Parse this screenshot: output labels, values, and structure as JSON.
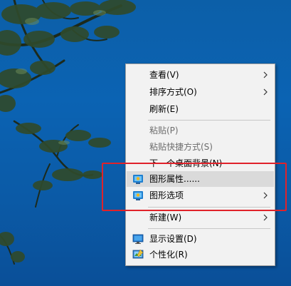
{
  "context_menu": {
    "items": [
      {
        "label": "查看(V)",
        "submenu": true,
        "disabled": false
      },
      {
        "label": "排序方式(O)",
        "submenu": true,
        "disabled": false
      },
      {
        "label": "刷新(E)",
        "submenu": false,
        "disabled": false
      },
      {
        "label": "粘贴(P)",
        "submenu": false,
        "disabled": true
      },
      {
        "label": "粘贴快捷方式(S)",
        "submenu": false,
        "disabled": true
      },
      {
        "label": "下一个桌面背景(N)",
        "submenu": false,
        "disabled": false
      },
      {
        "label": "图形属性......",
        "submenu": false,
        "disabled": false,
        "icon": "intel-graphics-icon",
        "highlighted": true
      },
      {
        "label": "图形选项",
        "submenu": true,
        "disabled": false,
        "icon": "intel-graphics-icon"
      },
      {
        "label": "新建(W)",
        "submenu": true,
        "disabled": false
      },
      {
        "label": "显示设置(D)",
        "submenu": false,
        "disabled": false,
        "icon": "display-icon"
      },
      {
        "label": "个性化(R)",
        "submenu": false,
        "disabled": false,
        "icon": "personalize-icon"
      }
    ]
  },
  "annotation": {
    "color": "#e0222a"
  },
  "colors": {
    "desktop_sky": "#0b63b3",
    "menu_bg": "#f2f2f2",
    "hover_bg": "#dadada"
  }
}
